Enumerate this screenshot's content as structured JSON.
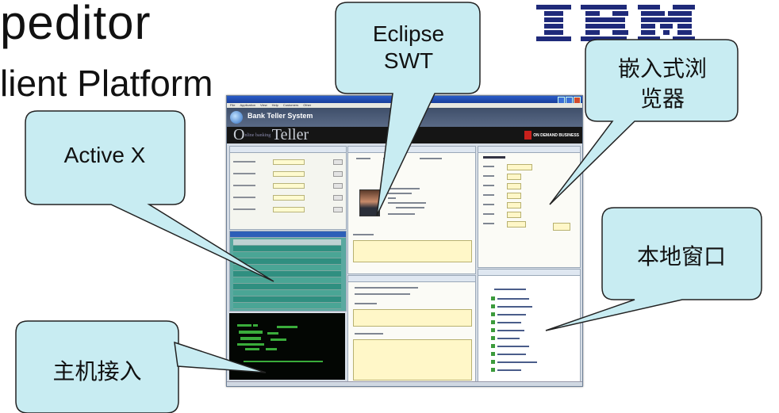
{
  "slide": {
    "title_line1": "peditor",
    "title_line2": "lient Platform"
  },
  "logo": {
    "name": "ibm-logo",
    "color": "#1f2a7a"
  },
  "app_window": {
    "app_title": "Bank Teller System",
    "brand_text": "Teller",
    "brand_prefix": "O",
    "ondemand_label": "ON DEMAND BUSINESS",
    "menu_items": [
      "File",
      "Application",
      "View",
      "Help",
      "Customers",
      "Other"
    ]
  },
  "callouts": {
    "eclipse_swt": "Eclipse\nSWT",
    "eclipse_line1": "Eclipse",
    "eclipse_line2": "SWT",
    "embedded_browser_line1": "嵌入式浏",
    "embedded_browser_line2": "览器",
    "active_x": "Active X",
    "native_window": "本地窗口",
    "host_access": "主机接入"
  },
  "colors": {
    "callout_fill": "#c8ecf2",
    "callout_stroke": "#222222",
    "brand_bar": "#151515",
    "ondemand_badge": "#c8201c"
  }
}
